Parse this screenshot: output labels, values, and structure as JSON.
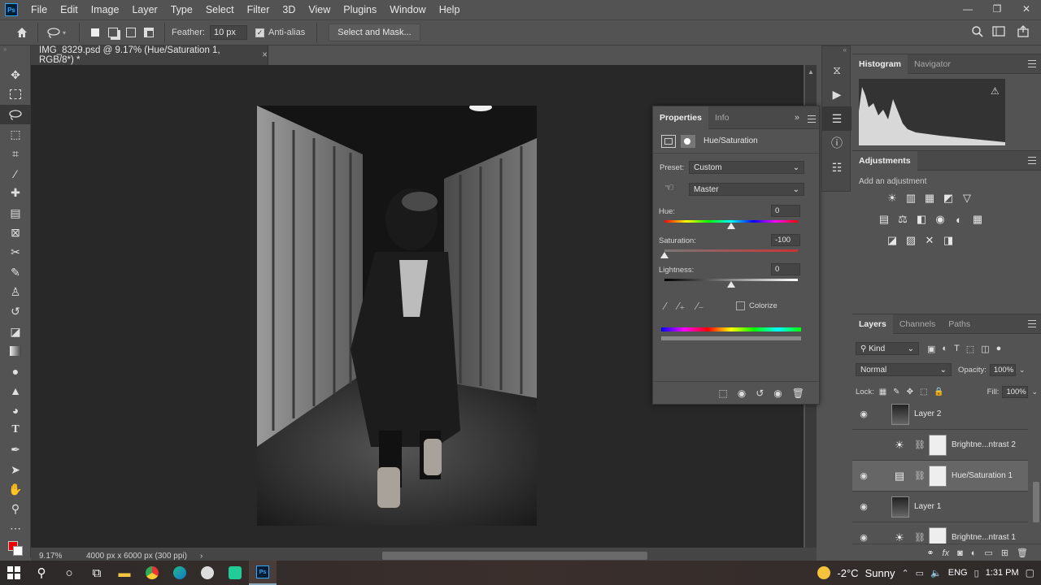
{
  "app": {
    "logo": "Ps",
    "menu": [
      "File",
      "Edit",
      "Image",
      "Layer",
      "Type",
      "Select",
      "Filter",
      "3D",
      "View",
      "Plugins",
      "Window",
      "Help"
    ],
    "window_controls": [
      "—",
      "❐",
      "✕"
    ]
  },
  "options_bar": {
    "feather_label": "Feather:",
    "feather_value": "10 px",
    "anti_alias_label": "Anti-alias",
    "anti_alias_checked": true,
    "select_mask_label": "Select and Mask..."
  },
  "document": {
    "tab_title": "IMG_8329.psd @ 9.17% (Hue/Saturation 1, RGB/8*) *",
    "tab_close": "×",
    "zoom": "9.17%",
    "doc_size": "4000 px x 6000 px (300 ppi)",
    "status_arrow": "›"
  },
  "properties": {
    "tabs": [
      "Properties",
      "Info"
    ],
    "active_tab": "Properties",
    "collapse": "»",
    "panel_title": "Hue/Saturation",
    "preset_label": "Preset:",
    "preset_value": "Custom",
    "channel_value": "Master",
    "hue_label": "Hue:",
    "hue_value": "0",
    "saturation_label": "Saturation:",
    "saturation_value": "-100",
    "lightness_label": "Lightness:",
    "lightness_value": "0",
    "hue_fraction": 0.5,
    "saturation_fraction": 0.0,
    "lightness_fraction": 0.5,
    "colorize_label": "Colorize",
    "colorize_checked": false
  },
  "histogram": {
    "tabs": [
      "Histogram",
      "Navigator"
    ],
    "warning": "⚠"
  },
  "adjustments": {
    "title": "Adjustments",
    "subtitle": "Add an adjustment",
    "icons": [
      "☀",
      "▥",
      "▦",
      "◩",
      "▽",
      "▤",
      "⚖",
      "◧",
      "◉",
      "◐",
      "▦",
      "◪",
      "▨",
      "✕",
      "◨"
    ]
  },
  "layers": {
    "tabs": [
      "Layers",
      "Channels",
      "Paths"
    ],
    "filter_label": "Kind",
    "blend_mode": "Normal",
    "opacity_label": "Opacity:",
    "opacity_value": "100%",
    "lock_label": "Lock:",
    "fill_label": "Fill:",
    "fill_value": "100%",
    "rows": [
      {
        "name": "Layer 2",
        "visible": true,
        "type": "image"
      },
      {
        "name": "Brightne...ntrast 2",
        "visible": false,
        "type": "adjustment"
      },
      {
        "name": "Hue/Saturation 1",
        "visible": true,
        "type": "huesat",
        "selected": true
      },
      {
        "name": "Layer 1",
        "visible": true,
        "type": "image"
      },
      {
        "name": "Brightne...ntrast 1",
        "visible": true,
        "type": "adjustment"
      }
    ]
  },
  "taskbar": {
    "weather_temp": "-2°C",
    "weather_text": "Sunny",
    "language": "ENG",
    "time": "1:31 PM"
  },
  "colors": {
    "ui_bg": "#535353",
    "canvas_bg": "#282828",
    "accent_ps": "#31a8ff"
  }
}
